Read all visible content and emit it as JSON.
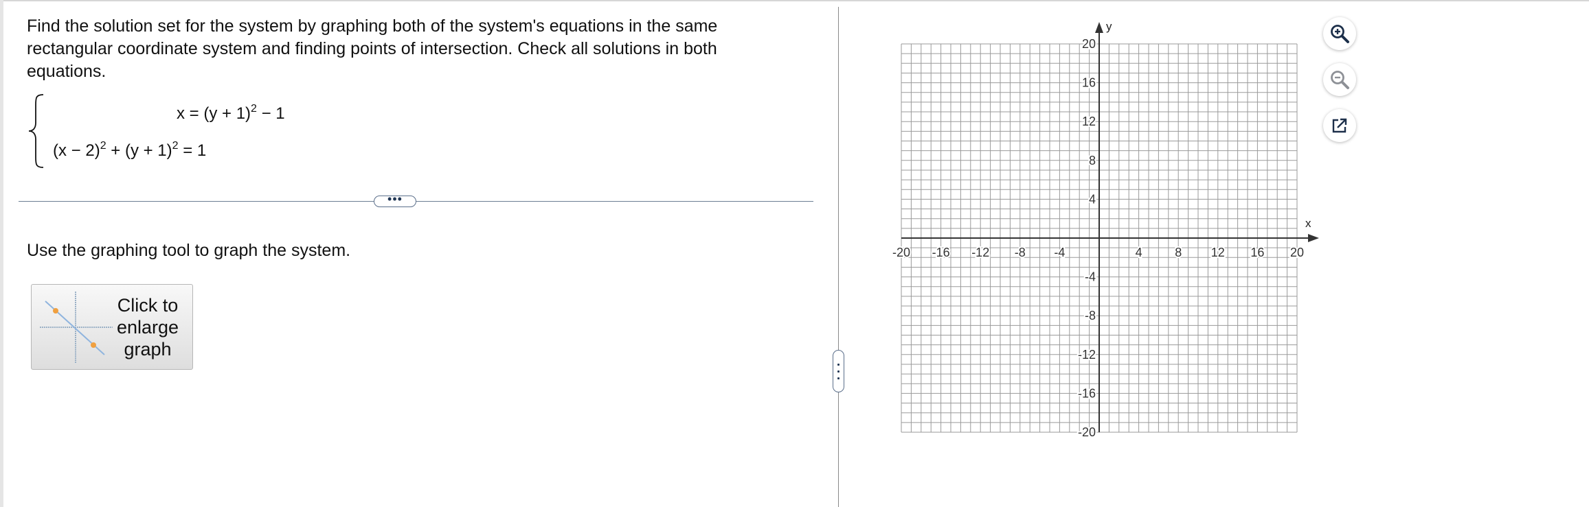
{
  "question": {
    "instructions": "Find the solution set for the system by graphing both of the system's equations in the same rectangular coordinate system and finding points of intersection. Check all solutions in both equations.",
    "equation1": {
      "lhs": "x = (y + 1)",
      "exp": "2",
      "rhs": " − 1"
    },
    "equation2": {
      "part1": "(x − 2)",
      "exp1": "2",
      "part2": " + (y + 1)",
      "exp2": "2",
      "rhs": " = 1"
    },
    "divider_handle": "•••",
    "tool_instructions": "Use the graphing tool to graph the system.",
    "enlarge_button_label": "Click to\nenlarge\ngraph"
  },
  "graph": {
    "x_axis_label": "x",
    "y_axis_label": "y",
    "x_range": [
      -20,
      20
    ],
    "y_range": [
      -20,
      20
    ],
    "grid_step": 1,
    "x_tick_labels": [
      "-20",
      "-16",
      "-12",
      "-8",
      "-4",
      "4",
      "8",
      "12",
      "16",
      "20"
    ],
    "y_tick_labels": [
      "20",
      "16",
      "12",
      "8",
      "4",
      "-4",
      "-8",
      "-12",
      "-16",
      "-20"
    ],
    "grid_color": "#9a9a9a",
    "axis_color": "#333333"
  },
  "toolbar": {
    "zoom_in_icon": "zoom-in-icon",
    "zoom_out_icon": "zoom-out-icon",
    "popout_icon": "popout-icon"
  }
}
